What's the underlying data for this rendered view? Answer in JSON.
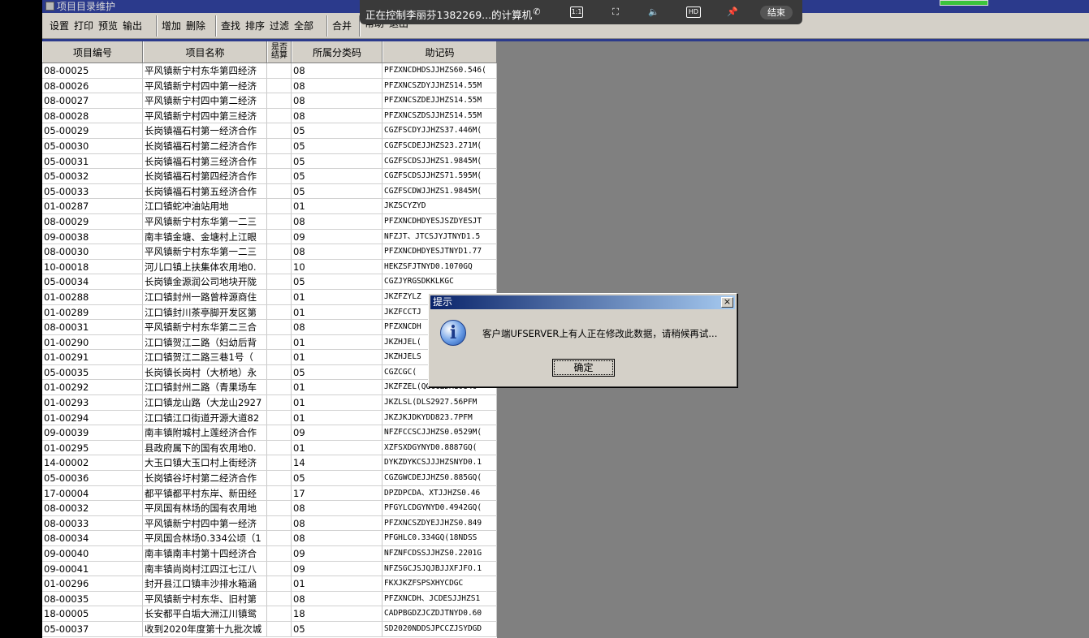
{
  "app": {
    "title": "项目目录维护"
  },
  "toolbar": {
    "groups": [
      [
        "设置",
        "打印",
        "预览",
        "输出"
      ],
      [
        "增加",
        "删除"
      ],
      [
        "查找",
        "排序",
        "过滤",
        "全部"
      ],
      [
        "合并"
      ],
      [
        "帮助",
        "退出"
      ]
    ]
  },
  "grid": {
    "headers": [
      "项目编号",
      "项目名称",
      "是否结算",
      "所属分类码",
      "助记码"
    ],
    "rows": [
      [
        "08-00025",
        "平风镇新宁村东华第四经济",
        "",
        "08",
        "PFZXNCDHDSJJHZS60.546("
      ],
      [
        "08-00026",
        "平风镇新宁村四中第一经济",
        "",
        "08",
        "PFZXNCSZDYJJHZS14.55M"
      ],
      [
        "08-00027",
        "平风镇新宁村四中第二经济",
        "",
        "08",
        "PFZXNCSZDEJJHZS14.55M"
      ],
      [
        "08-00028",
        "平风镇新宁村四中第三经济",
        "",
        "08",
        "PFZXNCSZDSJJHZS14.55M"
      ],
      [
        "05-00029",
        "长岗镇福石村第一经济合作",
        "",
        "05",
        "CGZFSCDYJJHZS37.446M("
      ],
      [
        "05-00030",
        "长岗镇福石村第二经济合作",
        "",
        "05",
        "CGZFSCDEJJHZS23.271M("
      ],
      [
        "05-00031",
        "长岗镇福石村第三经济合作",
        "",
        "05",
        "CGZFSCDSJJHZS1.9845M("
      ],
      [
        "05-00032",
        "长岗镇福石村第四经济合作",
        "",
        "05",
        "CGZFSCDSJJHZS71.595M("
      ],
      [
        "05-00033",
        "长岗镇福石村第五经济合作",
        "",
        "05",
        "CGZFSCDWJJHZS1.9845M("
      ],
      [
        "01-00287",
        "江口镇蛇冲油站用地",
        "",
        "01",
        "JKZSCYZYD"
      ],
      [
        "08-00029",
        "平风镇新宁村东华第一二三",
        "",
        "08",
        "PFZXNCDHDYESJSZDYESJT"
      ],
      [
        "09-00038",
        "南丰镇金塘、金塘村上江眼",
        "",
        "09",
        "NFZJT、JTCSJYJTNYD1.5"
      ],
      [
        "08-00030",
        "平风镇新宁村东华第一二三",
        "",
        "08",
        "PFZXNCDHDYESJTNYD1.77"
      ],
      [
        "10-00018",
        "河儿口镇上扶集体农用地0.",
        "",
        "10",
        "HEKZSFJTNYD0.1070GQ"
      ],
      [
        "05-00034",
        "长岗镇金源润公司地块开陇",
        "",
        "05",
        "CGZJYRGSDKKLKGC"
      ],
      [
        "01-00288",
        "江口镇封州一路曾梓源商住",
        "",
        "01",
        "JKZFZYLZ"
      ],
      [
        "01-00289",
        "江口镇封川茶亭脚开发区第",
        "",
        "01",
        "JKZFCCTJ"
      ],
      [
        "08-00031",
        "平风镇新宁村东华第二三合",
        "",
        "08",
        "PFZXNCDH"
      ],
      [
        "01-00290",
        "江口镇贺江二路（妇幼后背",
        "",
        "01",
        "JKZHJEL("
      ],
      [
        "01-00291",
        "江口镇贺江二路三巷1号（",
        "",
        "01",
        "JKZHJELS"
      ],
      [
        "05-00035",
        "长岗镇长岗村（大桥地）永",
        "",
        "05",
        "CGZCGC("
      ],
      [
        "01-00292",
        "江口镇封州二路（青果场车",
        "",
        "01",
        "JKZFZEL(QGCCZDM10846"
      ],
      [
        "01-00293",
        "江口镇龙山路（大龙山2927",
        "",
        "01",
        "JKZLSL(DLS2927.56PFM"
      ],
      [
        "01-00294",
        "江口镇江口街道开源大道82",
        "",
        "01",
        "JKZJKJDKYDD823.7PFM"
      ],
      [
        "09-00039",
        "南丰镇附城村上莲经济合作",
        "",
        "09",
        "NFZFCCSCJJHZS0.0529M("
      ],
      [
        "01-00295",
        "县政府属下的国有农用地0.",
        "",
        "01",
        "XZFSXDGYNYD0.8887GQ("
      ],
      [
        "14-00002",
        "大玉口镇大玉口村上街经济",
        "",
        "14",
        "DYKZDYKCSJJJHZSNYD0.1"
      ],
      [
        "05-00036",
        "长岗镇谷圩村第二经济合作",
        "",
        "05",
        "CGZGWCDEJJHZS0.885GQ("
      ],
      [
        "17-00004",
        "都平镇都平村东岸、新田经",
        "",
        "17",
        "DPZDPCDA、XTJJHZS0.46"
      ],
      [
        "08-00032",
        "平凤国有林场的国有农用地",
        "",
        "08",
        "PFGYLCDGYNYD0.4942GQ("
      ],
      [
        "08-00033",
        "平风镇新宁村四中第一经济",
        "",
        "08",
        "PFZXNCSZDYEJJHZS0.849"
      ],
      [
        "08-00034",
        "平凤国合林场0.334公顷（1",
        "",
        "08",
        "PFGHLC0.334GQ(18NDSS"
      ],
      [
        "09-00040",
        "南丰镇南丰村第十四经济合",
        "",
        "09",
        "NFZNFCDSSJJHZS0.2201G"
      ],
      [
        "09-00041",
        "南丰镇尚岗村江四江七江八",
        "",
        "09",
        "NFZSGCJSJQJBJJXFJFO.1"
      ],
      [
        "01-00296",
        "封开县江口镇丰沙排水箱涵",
        "",
        "01",
        "FKXJKZFSPSXHYCDGC"
      ],
      [
        "08-00035",
        "平风镇新宁村东华、旧村第",
        "",
        "08",
        "PFZXNCDH、JCDESJJHZS1"
      ],
      [
        "18-00005",
        "长安都平白垢大洲江川镇鸳",
        "",
        "18",
        "CADPBGDZJCZDJTNYD0.60"
      ],
      [
        "05-00037",
        "收到2020年度第十九批次城",
        "",
        "05",
        "SD2020NDDSJPCCZJSYDGD"
      ]
    ]
  },
  "remote": {
    "title": "正在控制李丽芬1382269...的计算机",
    "ratio_label": "1:1",
    "hd_label": "HD",
    "end_label": "结束"
  },
  "dialog": {
    "title": "提示",
    "close_label": "×",
    "icon": "info-icon",
    "message": "客户端UFSERVER上有人正在修改此数据，请稍候再试...",
    "ok_label": "确定"
  }
}
